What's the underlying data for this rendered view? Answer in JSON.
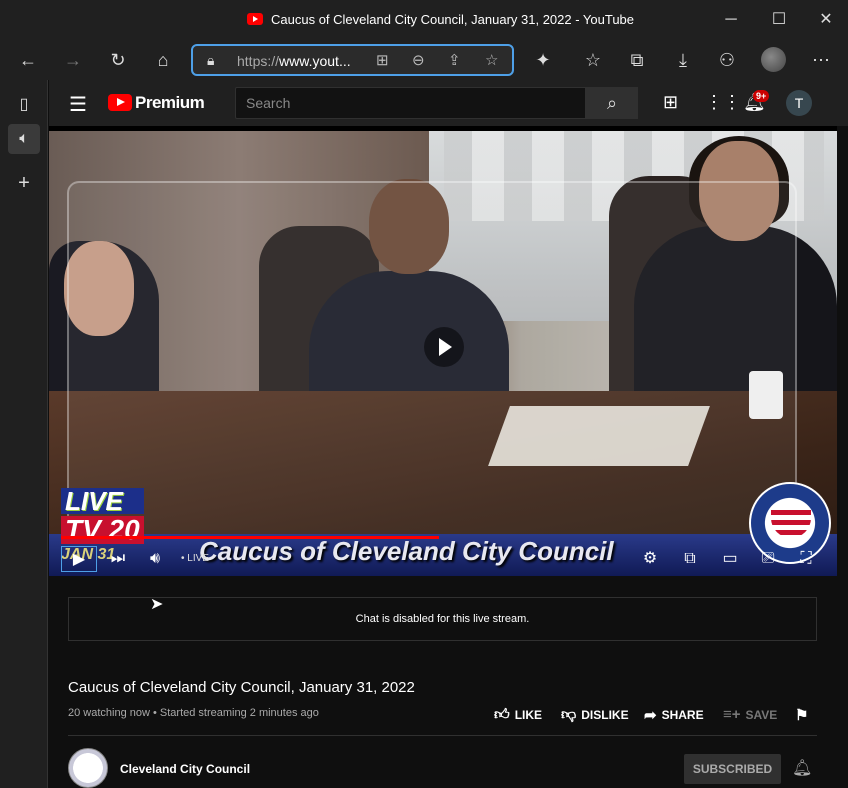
{
  "window": {
    "title": "Caucus of Cleveland City Council, January 31, 2022 - YouTube",
    "minimize": "─",
    "maximize": "☐",
    "close": "✕"
  },
  "browser": {
    "url_prefix": "https://",
    "url_domain": "www.yout...",
    "icons": [
      "back-icon",
      "forward-icon",
      "refresh-icon",
      "home-icon",
      "lock-icon",
      "split-screen-icon",
      "zoom-out-icon",
      "share-icon",
      "add-favorite-icon",
      "extensions-icon",
      "favorites-icon",
      "collections-icon",
      "downloads-icon",
      "games-icon",
      "more-icon"
    ]
  },
  "sidebar": {
    "icons": [
      "tabs-icon",
      "audio-icon",
      "add-icon"
    ]
  },
  "youtube": {
    "brand": "Premium",
    "search_placeholder": "Search",
    "notification_count": "9+",
    "user_initial": "T"
  },
  "player": {
    "overlay_live": "LIVE",
    "overlay_tv": "TV 20",
    "overlay_date": "JAN 31",
    "overlay_title": "Caucus of Cleveland City Council",
    "live_label": "• LIVE",
    "progress": 0.48
  },
  "chat": {
    "message": "Chat is disabled for this live stream."
  },
  "video": {
    "title": "Caucus of Cleveland City Council, January 31, 2022",
    "meta": "20 watching now • Started streaming 2 minutes ago",
    "like": "LIKE",
    "dislike": "DISLIKE",
    "share": "SHARE",
    "save": "SAVE"
  },
  "channel": {
    "name": "Cleveland City Council",
    "subscribe_label": "SUBSCRIBED"
  },
  "colors": {
    "accent": "#4ea0e8",
    "yt_red": "#ff0000",
    "bg": "#0f0f0f"
  }
}
